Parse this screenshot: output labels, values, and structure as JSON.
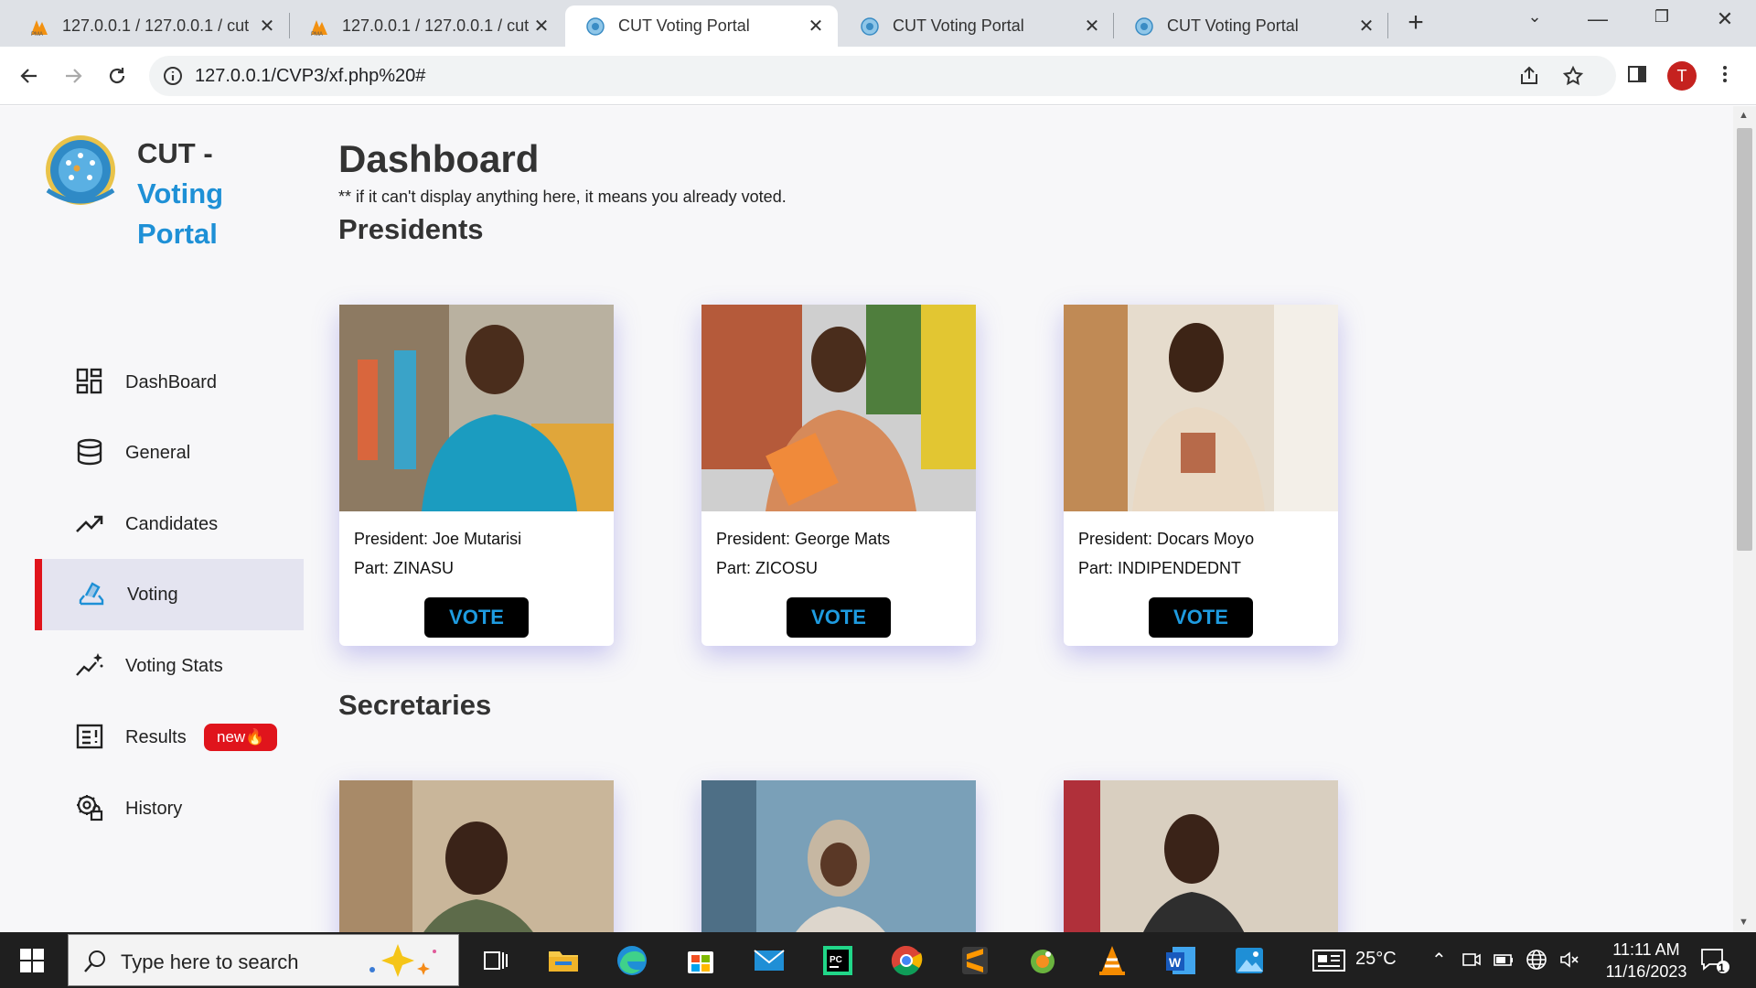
{
  "browser": {
    "tabs": [
      {
        "title": "127.0.0.1 / 127.0.0.1 / cut",
        "icon": "phpmyadmin-icon",
        "active": false
      },
      {
        "title": "127.0.0.1 / 127.0.0.1 / cut",
        "icon": "phpmyadmin-icon",
        "active": false
      },
      {
        "title": "CUT Voting Portal",
        "icon": "globe-icon",
        "active": true
      },
      {
        "title": "CUT Voting Portal",
        "icon": "globe-icon",
        "active": false
      },
      {
        "title": "CUT Voting Portal",
        "icon": "globe-icon",
        "active": false
      }
    ],
    "url": "127.0.0.1/CVP3/xf.php%20#",
    "avatar_letter": "T"
  },
  "sidebar": {
    "brand": {
      "line1": "CUT -",
      "line2": "Voting",
      "line3": "Portal"
    },
    "items": [
      {
        "label": "DashBoard",
        "icon": "grid-icon"
      },
      {
        "label": "General",
        "icon": "database-icon"
      },
      {
        "label": "Candidates",
        "icon": "trending-up-icon"
      },
      {
        "label": "Voting",
        "icon": "ballot-icon",
        "active": true
      },
      {
        "label": "Voting Stats",
        "icon": "stats-sparkle-icon"
      },
      {
        "label": "Results",
        "icon": "results-icon",
        "badge": "new🔥"
      },
      {
        "label": "History",
        "icon": "history-lock-icon"
      }
    ],
    "accent_color": "#e0141c"
  },
  "main": {
    "title": "Dashboard",
    "note": "** if it can't display anything here, it means you already voted.",
    "sections": [
      {
        "title": "Presidents",
        "candidates": [
          {
            "name": "President: Joe Mutarisi",
            "party": "Part: ZINASU",
            "vote_label": "VOTE"
          },
          {
            "name": "President: George Mats",
            "party": "Part: ZICOSU",
            "vote_label": "VOTE"
          },
          {
            "name": "President: Docars Moyo",
            "party": "Part: INDIPENDEDNT",
            "vote_label": "VOTE"
          }
        ]
      },
      {
        "title": "Secretaries"
      }
    ],
    "vote_button_color": "#1e9be0"
  },
  "taskbar": {
    "search_placeholder": "Type here to search",
    "weather": "25°C",
    "time": "11:11 AM",
    "date": "11/16/2023",
    "notifications": "1"
  }
}
